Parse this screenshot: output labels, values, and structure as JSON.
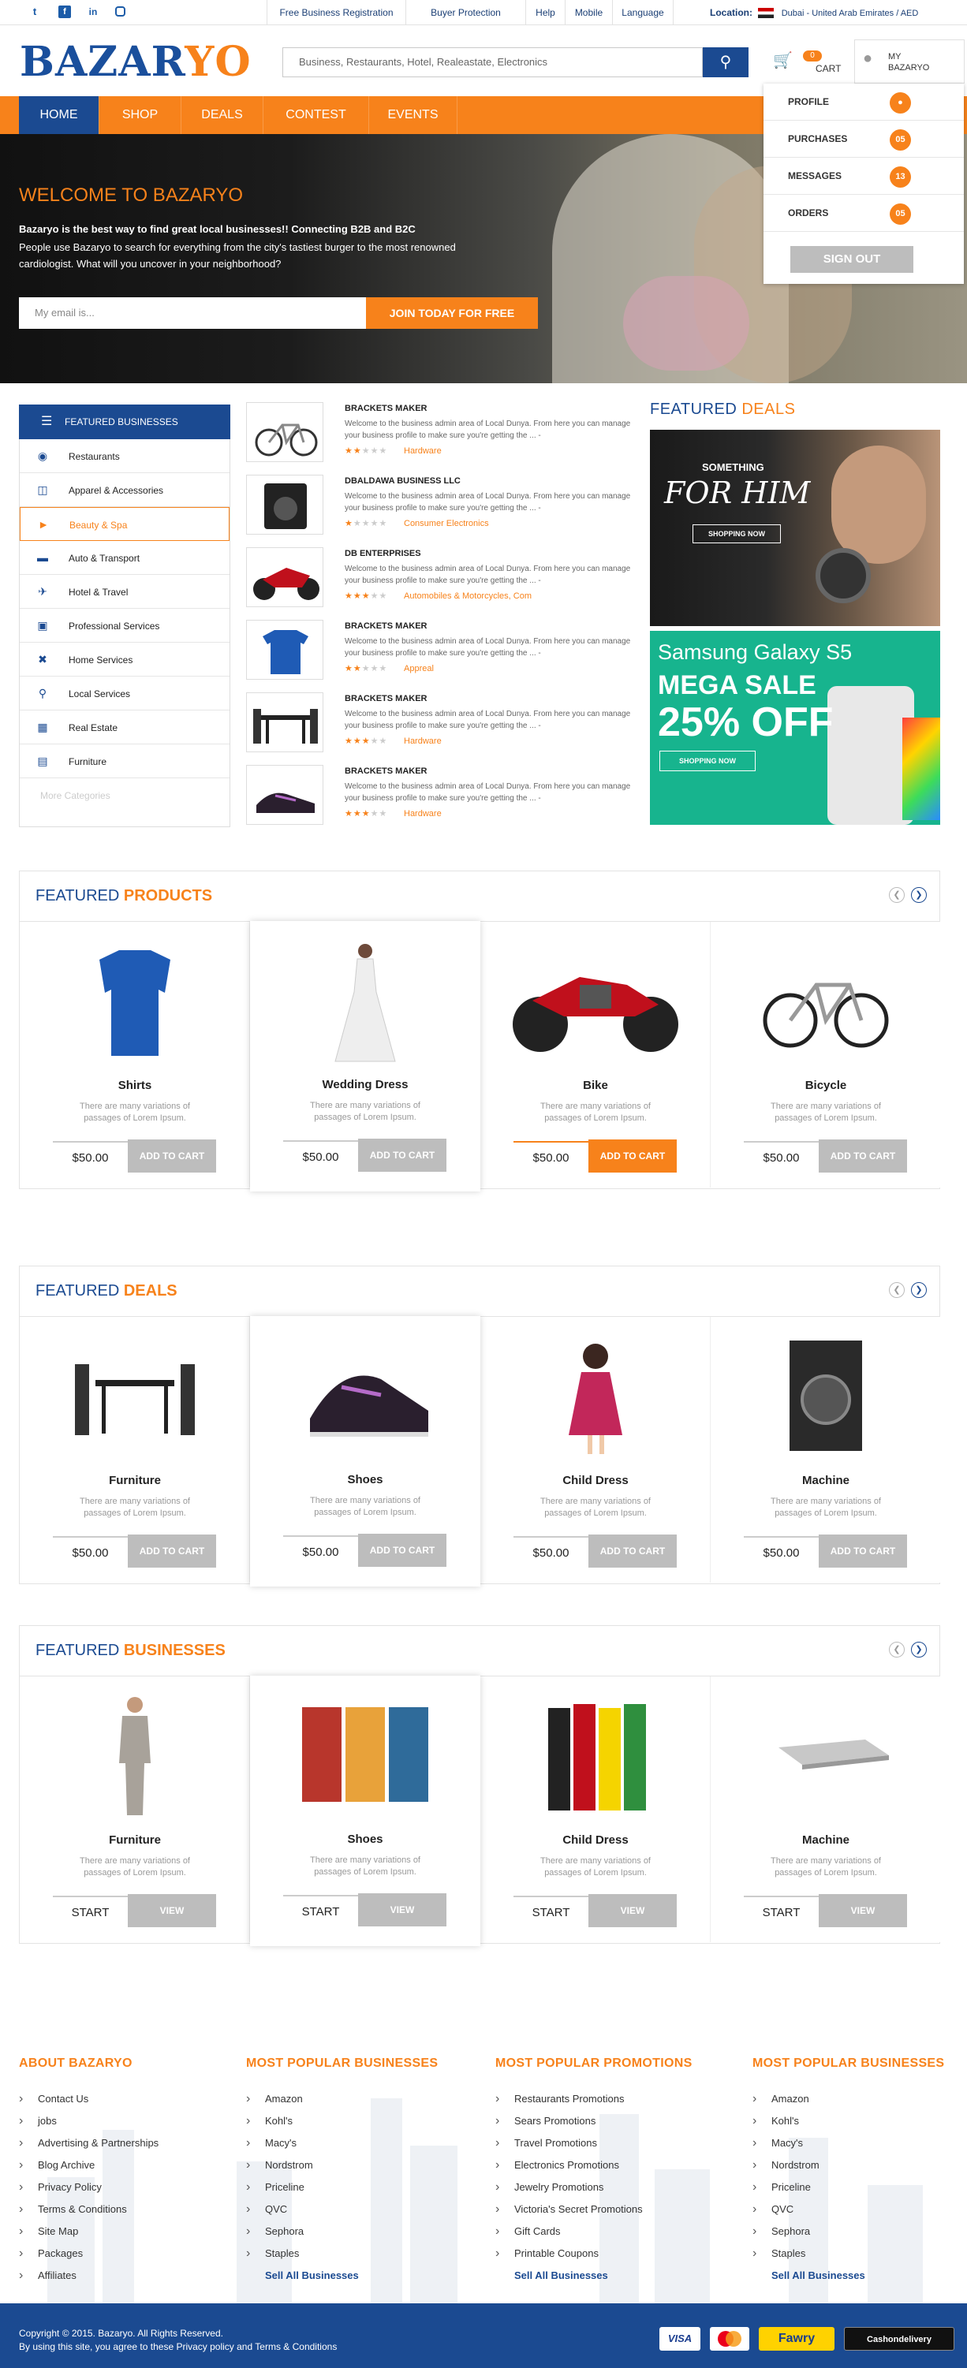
{
  "topbar": {
    "social": [
      "twitter-icon",
      "facebook-icon",
      "linkedin-icon",
      "instagram-icon"
    ],
    "links": [
      "Free Business Registration",
      "Buyer Protection",
      "Help",
      "Mobile",
      "Language"
    ],
    "location_label": "Location:",
    "location_value": "Dubai - United Arab Emirates / AED"
  },
  "header": {
    "logo_part1": "BAZAR",
    "logo_part2": "YO",
    "search_placeholder": "Business, Restaurants, Hotel, Realeastate, Electronics",
    "cart_count": "0",
    "cart_label": "CART",
    "my_label": "MY BAZARYO"
  },
  "nav": [
    "HOME",
    "SHOP",
    "DEALS",
    "CONTEST",
    "EVENTS"
  ],
  "dropdown": {
    "items": [
      {
        "label": "PROFILE",
        "badge": ""
      },
      {
        "label": "PURCHASES",
        "badge": "05"
      },
      {
        "label": "MESSAGES",
        "badge": "13"
      },
      {
        "label": "ORDERS",
        "badge": "05"
      }
    ],
    "signout": "SIGN OUT"
  },
  "hero": {
    "title": "WELCOME TO BAZARYO",
    "subtitle": "Bazaryo is the best way to find great local businesses!! Connecting B2B and B2C",
    "text": "People use Bazaryo to search for everything from the city's tastiest burger to the most renowned cardiologist. What will you uncover in your neighborhood?",
    "email_placeholder": "My email is...",
    "join_button": "JOIN TODAY FOR FREE"
  },
  "categories": {
    "header": "FEATURED BUSINESSES",
    "items": [
      {
        "label": "Restaurants",
        "icon": "restaurant-icon"
      },
      {
        "label": "Apparel &  Accessories",
        "icon": "basket-icon"
      },
      {
        "label": "Beauty & Spa",
        "icon": "hairdryer-icon"
      },
      {
        "label": "Auto & Transport",
        "icon": "car-icon"
      },
      {
        "label": "Hotel & Travel",
        "icon": "plane-icon"
      },
      {
        "label": "Professional Services",
        "icon": "briefcase-icon"
      },
      {
        "label": "Home Services",
        "icon": "tools-icon"
      },
      {
        "label": "Local Services",
        "icon": "pin-icon"
      },
      {
        "label": "Real Estate",
        "icon": "building-icon"
      },
      {
        "label": "Furniture",
        "icon": "furniture-icon"
      }
    ],
    "more": "More Categories"
  },
  "businesses": [
    {
      "name": "BRACKETS MAKER",
      "desc": "Welcome to the business admin area of Local Dunya. From here you can manage your business profile to make sure you're getting the ... -",
      "rating": 2,
      "category": "Hardware"
    },
    {
      "name": "DBALDAWA BUSINESS LLC",
      "desc": "Welcome to the business admin area of Local Dunya. From here you can manage your business profile to make sure you're getting the ... -",
      "rating": 1,
      "category": "Consumer Electronics"
    },
    {
      "name": "DB ENTERPRISES",
      "desc": "Welcome to the business admin area of Local Dunya. From here you can manage your business profile to make sure you're getting the ... -",
      "rating": 3,
      "category": "Automobiles & Motorcycles, Com"
    },
    {
      "name": "BRACKETS MAKER",
      "desc": "Welcome to the business admin area of Local Dunya. From here you can manage your business profile to make sure you're getting the ... -",
      "rating": 2,
      "category": "Appreal"
    },
    {
      "name": "BRACKETS MAKER",
      "desc": "Welcome to the business admin area of Local Dunya. From here you can manage your business profile to make sure you're getting the ... -",
      "rating": 3,
      "category": "Hardware"
    },
    {
      "name": "BRACKETS MAKER",
      "desc": "Welcome to the business admin area of Local Dunya. From here you can manage your business profile to make sure you're getting the ... -",
      "rating": 3,
      "category": "Hardware"
    }
  ],
  "featured_deals_side": {
    "title1": "FEATURED ",
    "title2": "DEALS",
    "banner1": {
      "small": "SOMETHING",
      "big": "FOR HIM",
      "btn": "SHOPPING NOW"
    },
    "banner2": {
      "line1": "Samsung Galaxy S5",
      "line2": "MEGA SALE",
      "line3": "25% OFF",
      "btn": "SHOPPING NOW"
    }
  },
  "products": {
    "title1": "FEATURED ",
    "title2": "PRODUCTS",
    "items": [
      {
        "name": "Shirts",
        "desc": "There are many variations of passages of Lorem Ipsum.",
        "price": "$50.00",
        "btn": "ADD TO CART"
      },
      {
        "name": "Wedding Dress",
        "desc": "There are many variations of passages of Lorem Ipsum.",
        "price": "$50.00",
        "btn": "ADD TO CART"
      },
      {
        "name": "Bike",
        "desc": "There are many variations of passages of Lorem Ipsum.",
        "price": "$50.00",
        "btn": "ADD TO CART"
      },
      {
        "name": "Bicycle",
        "desc": "There are many variations of passages of Lorem Ipsum.",
        "price": "$50.00",
        "btn": "ADD TO CART"
      }
    ]
  },
  "deals": {
    "title1": "FEATURED ",
    "title2": "DEALS",
    "items": [
      {
        "name": "Furniture",
        "desc": "There are many variations of passages of Lorem Ipsum.",
        "price": "$50.00",
        "btn": "ADD TO CART"
      },
      {
        "name": "Shoes",
        "desc": "There are many variations of passages of Lorem Ipsum.",
        "price": "$50.00",
        "btn": "ADD TO CART"
      },
      {
        "name": "Child Dress",
        "desc": "There are many variations of passages of Lorem Ipsum.",
        "price": "$50.00",
        "btn": "ADD TO CART"
      },
      {
        "name": "Machine",
        "desc": "There are many variations of passages of Lorem Ipsum.",
        "price": "$50.00",
        "btn": "ADD TO CART"
      }
    ]
  },
  "featured_businesses": {
    "title1": "FEATURED ",
    "title2": "BUSINESSES",
    "items": [
      {
        "name": "Furniture",
        "desc": "There are many variations of passages of Lorem Ipsum.",
        "price": "START",
        "btn": "VIEW"
      },
      {
        "name": "Shoes",
        "desc": "There are many variations of passages of Lorem Ipsum.",
        "price": "START",
        "btn": "VIEW"
      },
      {
        "name": "Child Dress",
        "desc": "There are many variations of passages of Lorem Ipsum.",
        "price": "START",
        "btn": "VIEW"
      },
      {
        "name": "Machine",
        "desc": "There are many variations of passages of Lorem Ipsum.",
        "price": "START",
        "btn": "VIEW"
      }
    ]
  },
  "footer": {
    "col1": {
      "title": "ABOUT BAZARYO",
      "items": [
        "Contact Us",
        "jobs",
        "Advertising & Partnerships",
        "Blog Archive",
        "Privacy Policy",
        "Terms & Conditions",
        "Site Map",
        "Packages",
        "Affiliates"
      ]
    },
    "col2": {
      "title": "MOST POPULAR BUSINESSES",
      "items": [
        "Amazon",
        "Kohl's",
        "Macy's",
        "Nordstrom",
        "Priceline",
        "QVC",
        "Sephora",
        "Staples"
      ],
      "more": "Sell All Businesses"
    },
    "col3": {
      "title": "MOST POPULAR PROMOTIONS",
      "items": [
        "Restaurants Promotions",
        "Sears Promotions",
        "Travel Promotions",
        "Electronics Promotions",
        "Jewelry Promotions",
        "Victoria's Secret Promotions",
        "Gift Cards",
        "Printable Coupons"
      ],
      "more": "Sell All Businesses"
    },
    "col4": {
      "title": "MOST POPULAR BUSINESSES",
      "items": [
        "Amazon",
        "Kohl's",
        "Macy's",
        "Nordstrom",
        "Priceline",
        "QVC",
        "Sephora",
        "Staples"
      ],
      "more": "Sell All Businesses"
    }
  },
  "copyright": {
    "line1": "Copyright © 2015. Bazaryo. All Rights Reserved.",
    "line2": "By using this site, you agree to these Privacy policy and Terms & Conditions",
    "payments": [
      "VISA",
      "MasterCard",
      "Fawry",
      "Cashondelivery"
    ]
  },
  "colors": {
    "orange": "#f7821b",
    "blue": "#1b4a91"
  }
}
